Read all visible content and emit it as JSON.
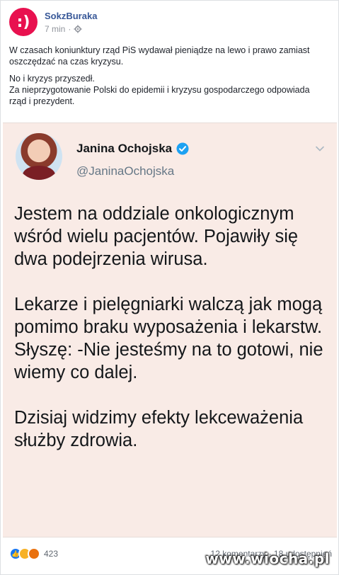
{
  "post": {
    "page_name": "SokzBuraka",
    "time": "7 min",
    "text": [
      "W czasach koniunktury rząd PiS wydawał pieniądze na lewo i prawo zamiast oszczędzać na czas kryzysu.",
      "No i kryzys przyszedł.",
      "Za nieprzygotowanie Polski do epidemii i kryzysu gospodarczego odpowiada rząd i prezydent."
    ]
  },
  "tweet": {
    "author_name": "Janina Ochojska",
    "handle": "@JaninaOchojska",
    "paragraphs": [
      "Jestem na oddziale onkologicznym wśród wielu pacjentów. Pojawiły się dwa podejrzenia wirusa.",
      "Lekarze i pielęgniarki walczą jak mogą pomimo braku wyposażenia i lekarstw. Słyszę: -Nie jesteśmy na to gotowi, nie wiemy co dalej.",
      "Dzisiaj widzimy efekty lekceważenia służby zdrowia."
    ]
  },
  "footer": {
    "reaction_count": "423",
    "comments_shares": "12 komentarzy · 18 udostępnień"
  },
  "watermark": "www.wiocha.pl",
  "colors": {
    "page_avatar": "#e8114f",
    "link": "#385898",
    "tweet_bg": "#f9ebe6",
    "verified": "#1da1f2"
  }
}
